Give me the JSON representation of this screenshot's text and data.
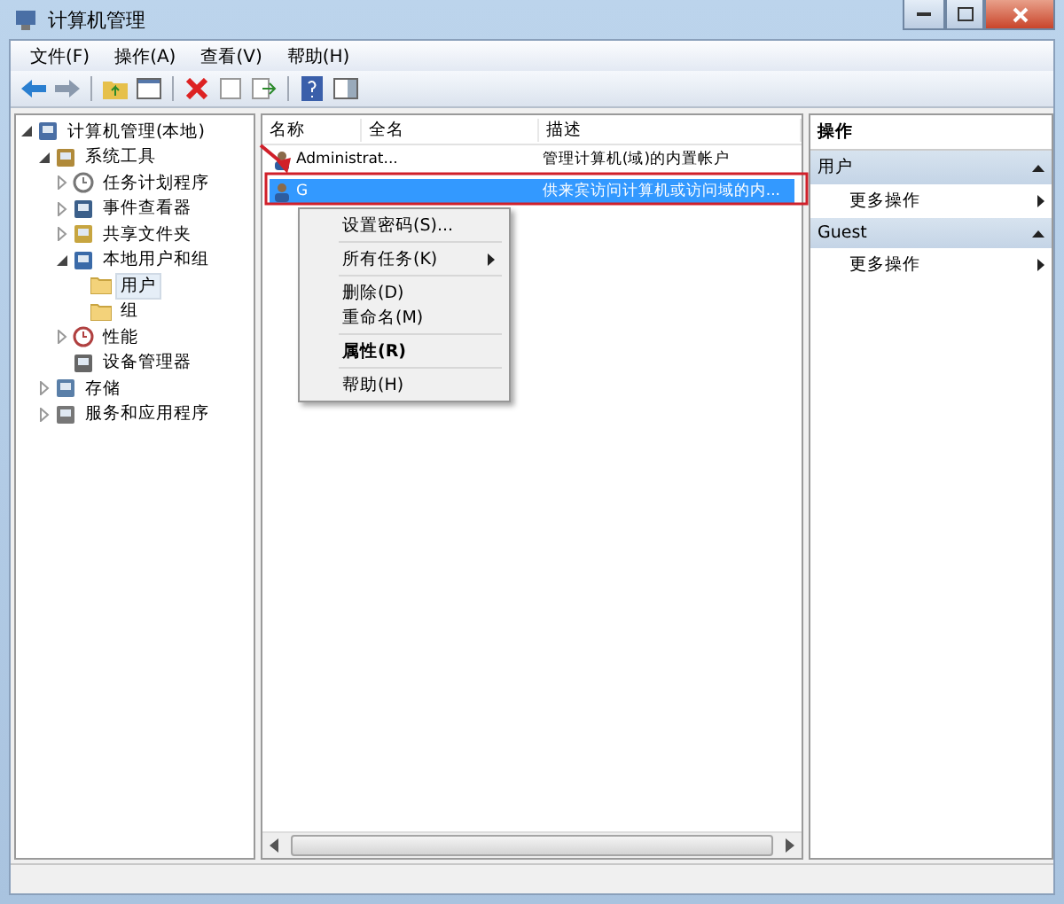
{
  "window": {
    "title": "计算机管理"
  },
  "menu": [
    "文件(F)",
    "操作(A)",
    "查看(V)",
    "帮助(H)"
  ],
  "tree": [
    {
      "label": "计算机管理(本地)",
      "expanded": true,
      "selected": false,
      "children": [
        {
          "label": "系统工具",
          "expanded": true,
          "selected": false,
          "children": [
            {
              "label": "任务计划程序",
              "expanded": false,
              "selected": false
            },
            {
              "label": "事件查看器",
              "expanded": false,
              "selected": false
            },
            {
              "label": "共享文件夹",
              "expanded": false,
              "selected": false
            },
            {
              "label": "本地用户和组",
              "expanded": true,
              "selected": false,
              "children": [
                {
                  "label": "用户",
                  "selected": true
                },
                {
                  "label": "组",
                  "selected": false
                }
              ]
            },
            {
              "label": "性能",
              "expanded": false,
              "selected": false
            },
            {
              "label": "设备管理器",
              "selected": false
            }
          ]
        },
        {
          "label": "存储",
          "expanded": false,
          "selected": false
        },
        {
          "label": "服务和应用程序",
          "expanded": false,
          "selected": false
        }
      ]
    }
  ],
  "columns": [
    "名称",
    "全名",
    "描述"
  ],
  "rows": [
    {
      "name": "Administrat...",
      "description": "管理计算机(域)的内置帐户",
      "selected": false
    },
    {
      "name": "G",
      "description": "供来宾访问计算机或访问域的内...",
      "selected": true
    }
  ],
  "context_menu": [
    {
      "kind": "item",
      "label": "设置密码(S)...",
      "submenu": false,
      "bold": false
    },
    {
      "kind": "separator"
    },
    {
      "kind": "item",
      "label": "所有任务(K)",
      "submenu": true,
      "bold": false
    },
    {
      "kind": "separator"
    },
    {
      "kind": "item",
      "label": "删除(D)",
      "submenu": false,
      "bold": false
    },
    {
      "kind": "item",
      "label": "重命名(M)",
      "submenu": false,
      "bold": false
    },
    {
      "kind": "separator"
    },
    {
      "kind": "item",
      "label": "属性(R)",
      "submenu": false,
      "bold": true
    },
    {
      "kind": "separator"
    },
    {
      "kind": "item",
      "label": "帮助(H)",
      "submenu": false,
      "bold": false
    }
  ],
  "actions": {
    "title": "操作",
    "sections": [
      {
        "title": "用户",
        "items": [
          "更多操作"
        ]
      },
      {
        "title": "Guest",
        "items": [
          "更多操作"
        ]
      }
    ]
  }
}
